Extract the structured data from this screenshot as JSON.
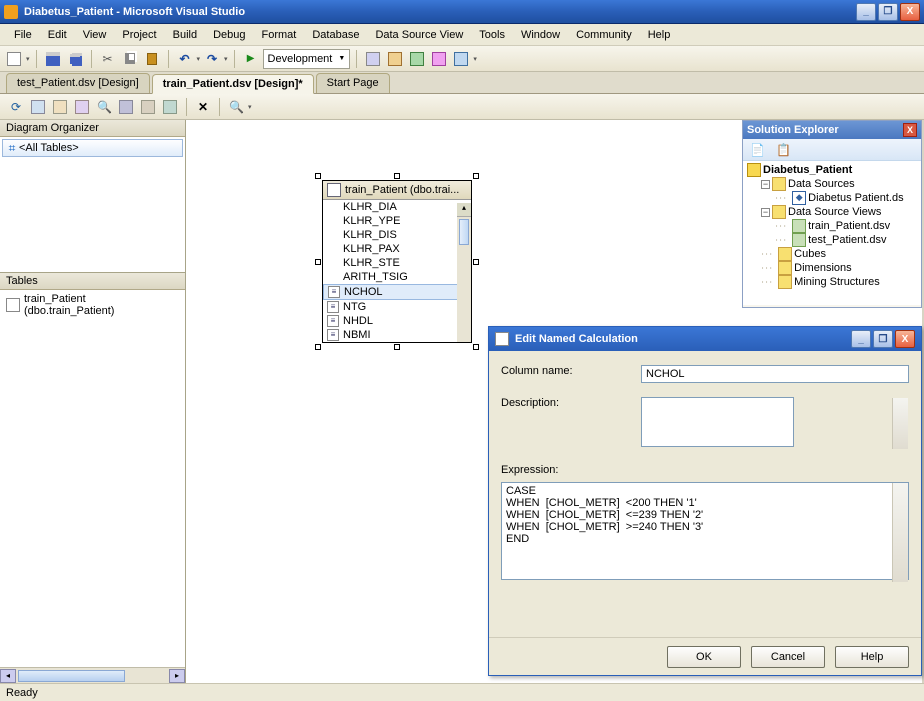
{
  "window": {
    "title": "Diabetus_Patient - Microsoft Visual Studio",
    "min": "_",
    "restore": "❐",
    "close": "X"
  },
  "menu": [
    "File",
    "Edit",
    "View",
    "Project",
    "Build",
    "Debug",
    "Format",
    "Database",
    "Data Source View",
    "Tools",
    "Window",
    "Community",
    "Help"
  ],
  "toolbar": {
    "dev_config": "Development"
  },
  "tabs": [
    {
      "label": "test_Patient.dsv [Design]",
      "active": false
    },
    {
      "label": "train_Patient.dsv [Design]*",
      "active": true
    },
    {
      "label": "Start Page",
      "active": false
    }
  ],
  "dsv_toolbar": {
    "delete_glyph": "✕",
    "zoom_in": "+",
    "zoom_out": "−"
  },
  "left": {
    "organizer_title": "Diagram Organizer",
    "organizer_item": "<All Tables>",
    "tables_title": "Tables",
    "tables_item": "train_Patient (dbo.train_Patient)"
  },
  "table_widget": {
    "header": "train_Patient (dbo.trai...",
    "columns": [
      "KLHR_DIA",
      "KLHR_YPE",
      "KLHR_DIS",
      "KLHR_PAX",
      "KLHR_STE",
      "ARITH_TSIG",
      "NCHOL",
      "NTG",
      "NHDL",
      "NBMI"
    ],
    "selected": "NCHOL"
  },
  "solution_explorer": {
    "title": "Solution Explorer",
    "project": "Diabetus_Patient",
    "folders": {
      "data_sources": {
        "label": "Data Sources",
        "items": [
          "Diabetus Patient.ds"
        ]
      },
      "dsv": {
        "label": "Data Source Views",
        "items": [
          "train_Patient.dsv",
          "test_Patient.dsv"
        ]
      },
      "cubes": "Cubes",
      "dimensions": "Dimensions",
      "mining": "Mining Structures"
    }
  },
  "dialog": {
    "title": "Edit Named Calculation",
    "column_name_label": "Column name:",
    "column_name_value": "NCHOL",
    "description_label": "Description:",
    "description_value": "",
    "expression_label": "Expression:",
    "expression_value": "CASE\nWHEN  [CHOL_METR]  <200 THEN '1'\nWHEN  [CHOL_METR]  <=239 THEN '2'\nWHEN  [CHOL_METR]  >=240 THEN '3'\nEND",
    "ok": "OK",
    "cancel": "Cancel",
    "help": "Help"
  },
  "status": {
    "text": "Ready"
  }
}
